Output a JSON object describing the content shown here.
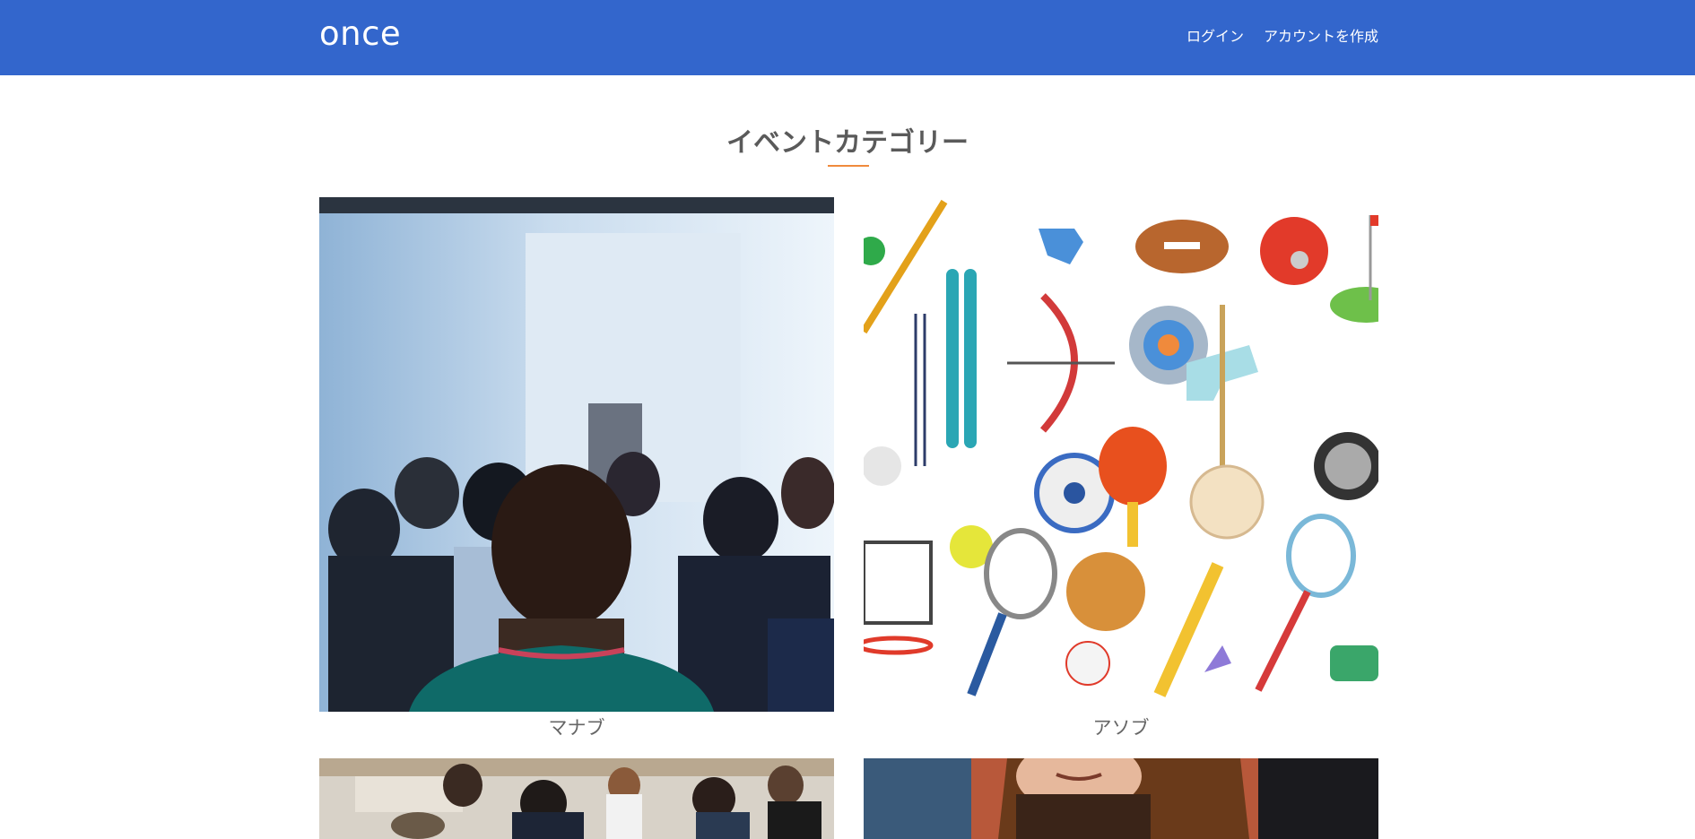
{
  "header": {
    "brand": "once",
    "nav": [
      {
        "label": "ログイン"
      },
      {
        "label": "アカウントを作成"
      }
    ]
  },
  "main": {
    "section_title": "イベントカテゴリー",
    "categories": [
      {
        "label": "マナブ",
        "image": "seminar-audience-photo"
      },
      {
        "label": "アソブ",
        "image": "sports-equipment-illustration"
      },
      {
        "label": "",
        "image": "cafe-people-photo"
      },
      {
        "label": "",
        "image": "woman-portrait-photo"
      }
    ]
  },
  "colors": {
    "navbar": "#3366cc",
    "accent_underline": "#f08a3c",
    "title_text": "#5a5a5a",
    "label_text": "#666666"
  }
}
